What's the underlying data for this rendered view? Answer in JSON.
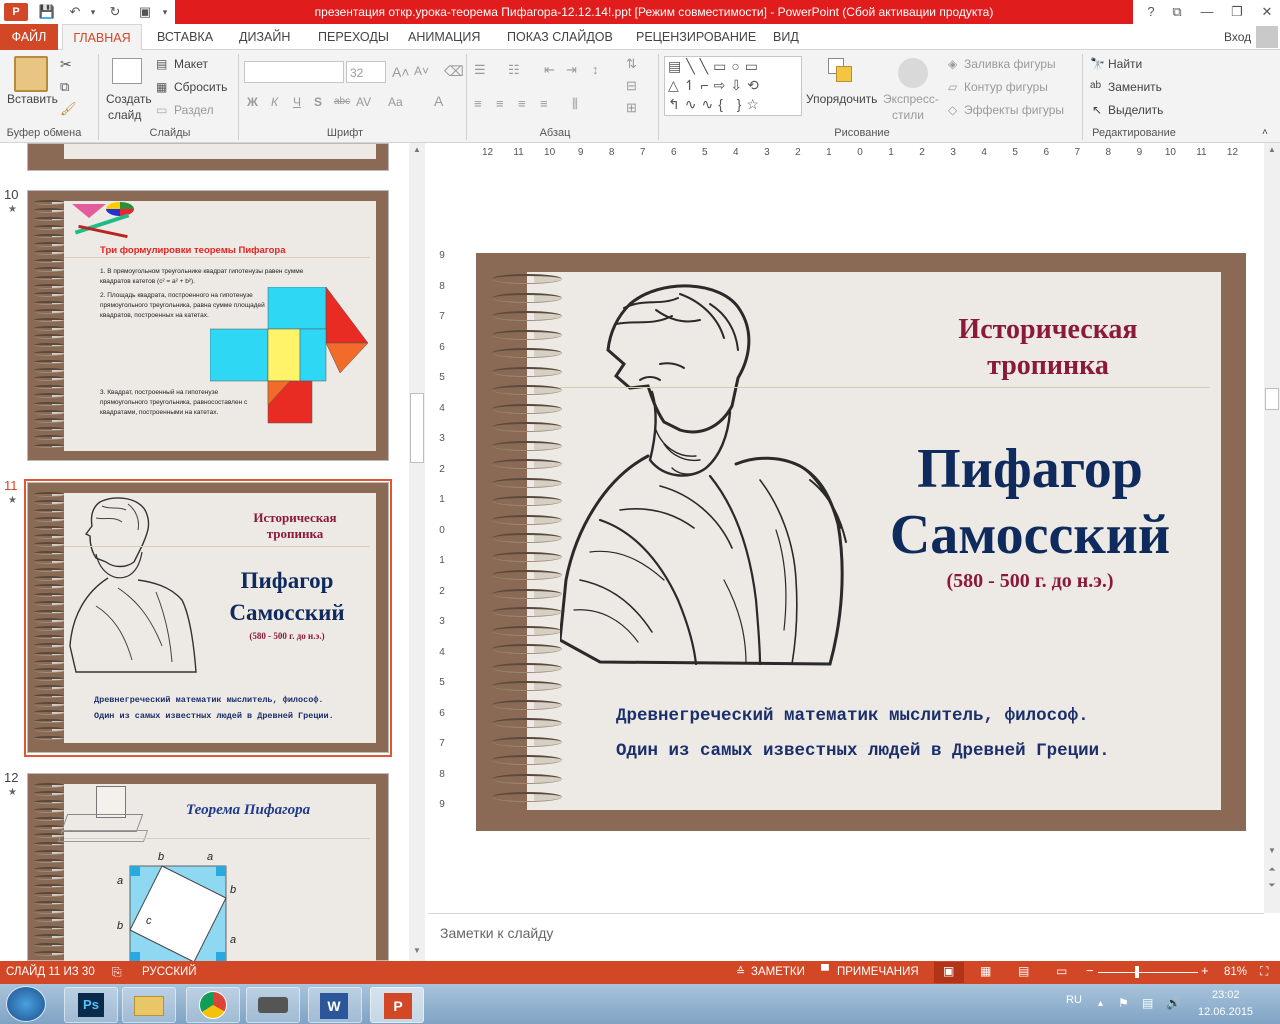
{
  "window": {
    "title": "презентация откр.урока-теорема Пифагора-12.12.14!.ppt [Режим совместимости] - PowerPoint (Сбой активации продукта)",
    "controls": [
      "?",
      "⧉",
      "—",
      "❐",
      "✕"
    ],
    "login": "Вход"
  },
  "tabs": {
    "file": "ФАЙЛ",
    "home": "ГЛАВНАЯ",
    "items": [
      "ВСТАВКА",
      "ДИЗАЙН",
      "ПЕРЕХОДЫ",
      "АНИМАЦИЯ",
      "ПОКАЗ СЛАЙДОВ",
      "РЕЦЕНЗИРОВАНИЕ",
      "ВИД"
    ]
  },
  "ribbon": {
    "clipboard": {
      "paste": "Вставить",
      "group": "Буфер обмена"
    },
    "slides": {
      "new_slide_1": "Создать",
      "new_slide_2": "слайд",
      "layout": "Макет",
      "reset": "Сбросить",
      "section": "Раздел",
      "group": "Слайды"
    },
    "font": {
      "size": "32",
      "group": "Шрифт"
    },
    "paragraph": {
      "group": "Абзац"
    },
    "drawing": {
      "arrange": "Упорядочить",
      "quick_styles_1": "Экспресс-",
      "quick_styles_2": "стили",
      "fill": "Заливка фигуры",
      "outline": "Контур фигуры",
      "effects": "Эффекты фигуры",
      "group": "Рисование"
    },
    "editing": {
      "find": "Найти",
      "replace": "Заменить",
      "select": "Выделить",
      "group": "Редактирование"
    }
  },
  "thumbnails": {
    "slide10": {
      "number": "10",
      "title": "Три формулировки теоремы Пифагора",
      "item1": "1. В прямоугольном треугольнике квадрат гипотенузы равен сумме квадратов катетов (c² = a² + b²).",
      "item2": "2. Площадь квадрата, построенного на гипотенузе прямоугольного треугольника, равна сумме площадей квадратов, построенных на катетах.",
      "item3": "3. Квадрат, построенный на гипотенузе прямоугольного треугольника, равносоставлен с квадратами, построенными на катетах."
    },
    "slide11": {
      "number": "11",
      "heading": "Историческая тропинка",
      "name1": "Пифагор",
      "name2": "Самосский",
      "years": "(580 - 500 г. до н.э.)",
      "desc1": "Древнегреческий математик мыслитель, философ.",
      "desc2": "Один из самых известных людей в Древней Греции."
    },
    "slide12": {
      "number": "12",
      "title": "Теорема Пифагора",
      "labels": [
        "b",
        "a",
        "a",
        "b",
        "c",
        "b",
        "a"
      ]
    }
  },
  "ruler": {
    "h": [
      "12",
      "11",
      "10",
      "9",
      "8",
      "7",
      "6",
      "5",
      "4",
      "3",
      "2",
      "1",
      "0",
      "1",
      "2",
      "3",
      "4",
      "5",
      "6",
      "7",
      "8",
      "9",
      "10",
      "11",
      "12"
    ],
    "v": [
      "9",
      "8",
      "7",
      "6",
      "5",
      "4",
      "3",
      "2",
      "1",
      "0",
      "1",
      "2",
      "3",
      "4",
      "5",
      "6",
      "7",
      "8",
      "9"
    ]
  },
  "slide": {
    "heading_line1": "Историческая",
    "heading_line2": "тропинка",
    "name_line1": "Пифагор",
    "name_line2": "Самосский",
    "years": "(580 - 500 г. до н.э.)",
    "desc1": "Древнегреческий математик мыслитель, философ.",
    "desc2": "Один из самых известных людей в Древней Греции."
  },
  "notes": {
    "placeholder": "Заметки к слайду"
  },
  "status": {
    "slide": "СЛАЙД 11 ИЗ 30",
    "lang": "РУССКИЙ",
    "notes": "ЗАМЕТКИ",
    "comments": "ПРИМЕЧАНИЯ",
    "zoom": "81%",
    "zoom_level": 0.81
  },
  "taskbar": {
    "lang": "RU",
    "time": "23:02",
    "date": "12.06.2015",
    "apps": [
      "Ps",
      "Explorer",
      "Chrome",
      "Scanner",
      "Word",
      "PowerPoint"
    ]
  },
  "colors": {
    "accent": "#d24726",
    "title_red": "#e01c1c",
    "heading": "#8b1a3a",
    "name": "#0f2a5c",
    "desc": "#1a2f6b",
    "frame": "#8a6a55"
  }
}
